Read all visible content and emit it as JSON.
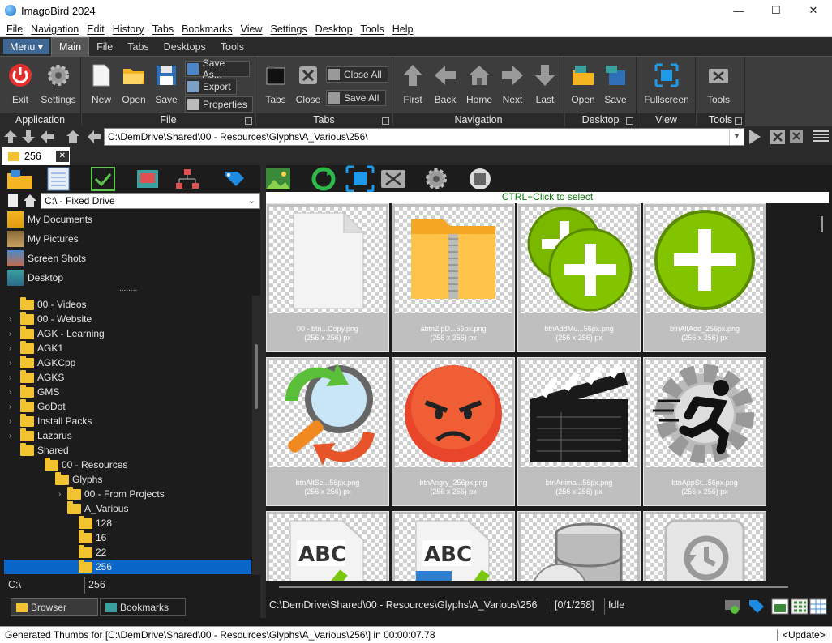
{
  "window": {
    "title": "ImagoBird 2024",
    "minimize": "—",
    "maximize": "☐",
    "close": "✕"
  },
  "menu": [
    "File",
    "Navigation",
    "Edit",
    "History",
    "Tabs",
    "Bookmarks",
    "View",
    "Settings",
    "Desktop",
    "Tools",
    "Help"
  ],
  "ribbon_tabs": {
    "menu": "Menu ▾",
    "tabs": [
      "Main",
      "File",
      "Tabs",
      "Desktops",
      "Tools"
    ]
  },
  "ribbon": {
    "application": {
      "label": "Application",
      "exit": "Exit",
      "settings": "Settings"
    },
    "file": {
      "label": "File",
      "new": "New",
      "open": "Open",
      "save": "Save",
      "save_as": "Save As...",
      "export": "Export",
      "properties": "Properties"
    },
    "tabs": {
      "label": "Tabs",
      "tabs": "Tabs",
      "close": "Close",
      "close_all": "Close All",
      "save_all": "Save All"
    },
    "navigation": {
      "label": "Navigation",
      "first": "First",
      "back": "Back",
      "home": "Home",
      "next": "Next",
      "last": "Last"
    },
    "desktop": {
      "label": "Desktop",
      "open": "Open",
      "save": "Save"
    },
    "view": {
      "label": "View",
      "fullscreen": "Fullscreen"
    },
    "tools": {
      "label": "Tools",
      "tools": "Tools"
    }
  },
  "address": "C:\\DemDrive\\Shared\\00 - Resources\\Glyphs\\A_Various\\256\\",
  "doc_tab": "256",
  "drive": "C:\\ - Fixed Drive",
  "shortcuts": [
    "My Documents",
    "My Pictures",
    "Screen Shots",
    "Desktop"
  ],
  "shortcuts_more": "........",
  "tree": [
    {
      "label": "00 - Videos",
      "depth": 0,
      "expander": false
    },
    {
      "label": "00 - Website",
      "depth": 0,
      "expander": true
    },
    {
      "label": "AGK - Learning",
      "depth": 0,
      "expander": true
    },
    {
      "label": "AGK1",
      "depth": 0,
      "expander": true
    },
    {
      "label": "AGKCpp",
      "depth": 0,
      "expander": true
    },
    {
      "label": "AGKS",
      "depth": 0,
      "expander": true
    },
    {
      "label": "GMS",
      "depth": 0,
      "expander": true
    },
    {
      "label": "GoDot",
      "depth": 0,
      "expander": true
    },
    {
      "label": "Install Packs",
      "depth": 0,
      "expander": true
    },
    {
      "label": "Lazarus",
      "depth": 0,
      "expander": true
    },
    {
      "label": "Shared",
      "depth": 0,
      "expander": false
    },
    {
      "label": "00 - Resources",
      "depth": 1,
      "expander": false
    },
    {
      "label": "Glyphs",
      "depth": 2,
      "expander": false
    },
    {
      "label": "00 - From Projects",
      "depth": 3,
      "expander": true
    },
    {
      "label": "A_Various",
      "depth": 3,
      "expander": false
    },
    {
      "label": "128",
      "depth": 4,
      "expander": false
    },
    {
      "label": "16",
      "depth": 4,
      "expander": false
    },
    {
      "label": "22",
      "depth": 4,
      "expander": false
    },
    {
      "label": "256",
      "depth": 4,
      "expander": false,
      "selected": true
    }
  ],
  "left_status": {
    "path": "C:\\",
    "folder": "256"
  },
  "bottom_tabs": {
    "browser": "Browser",
    "bookmarks": "Bookmarks"
  },
  "hint": "CTRL+Click to select",
  "thumbnails": [
    {
      "name": "00 - btn...Copy.png",
      "dim": "(256 x 256) px",
      "icon": "blank-page-icon"
    },
    {
      "name": "abtnZipD...56px.png",
      "dim": "(256 x 256) px",
      "icon": "zip-folder-icon"
    },
    {
      "name": "btnAddMu...56px.png",
      "dim": "(256 x 256) px",
      "icon": "add-multiple-icon"
    },
    {
      "name": "btnAltAdd_256px.png",
      "dim": "(256 x 256) px",
      "icon": "add-icon"
    },
    {
      "name": "btnAltSe...56px.png",
      "dim": "(256 x 256) px",
      "icon": "search-refresh-icon"
    },
    {
      "name": "btnAngry_256px.png",
      "dim": "(256 x 256) px",
      "icon": "angry-face-icon"
    },
    {
      "name": "btnAnima...56px.png",
      "dim": "(256 x 256) px",
      "icon": "clapperboard-icon"
    },
    {
      "name": "btnAppSt...56px.png",
      "dim": "(256 x 256) px",
      "icon": "app-start-icon"
    },
    {
      "name": "",
      "dim": "",
      "icon": "spellcheck-icon"
    },
    {
      "name": "",
      "dim": "",
      "icon": "spellcheck-blue-icon"
    },
    {
      "name": "",
      "dim": "",
      "icon": "database-disc-icon"
    },
    {
      "name": "",
      "dim": "",
      "icon": "history-drive-icon"
    }
  ],
  "status": {
    "path": "C:\\DemDrive\\Shared\\00 - Resources\\Glyphs\\A_Various\\256",
    "count": "[0/1/258]",
    "state": "Idle"
  },
  "footer": {
    "message": "Generated Thumbs for [C:\\DemDrive\\Shared\\00 - Resources\\Glyphs\\A_Various\\256\\] in 00:00:07.78",
    "update": "<Update>"
  },
  "colors": {
    "accent": "#0a66c8",
    "ribbon": "#3d3d3d",
    "dark": "#1c1c1c",
    "hint": "#0a7a0a"
  }
}
